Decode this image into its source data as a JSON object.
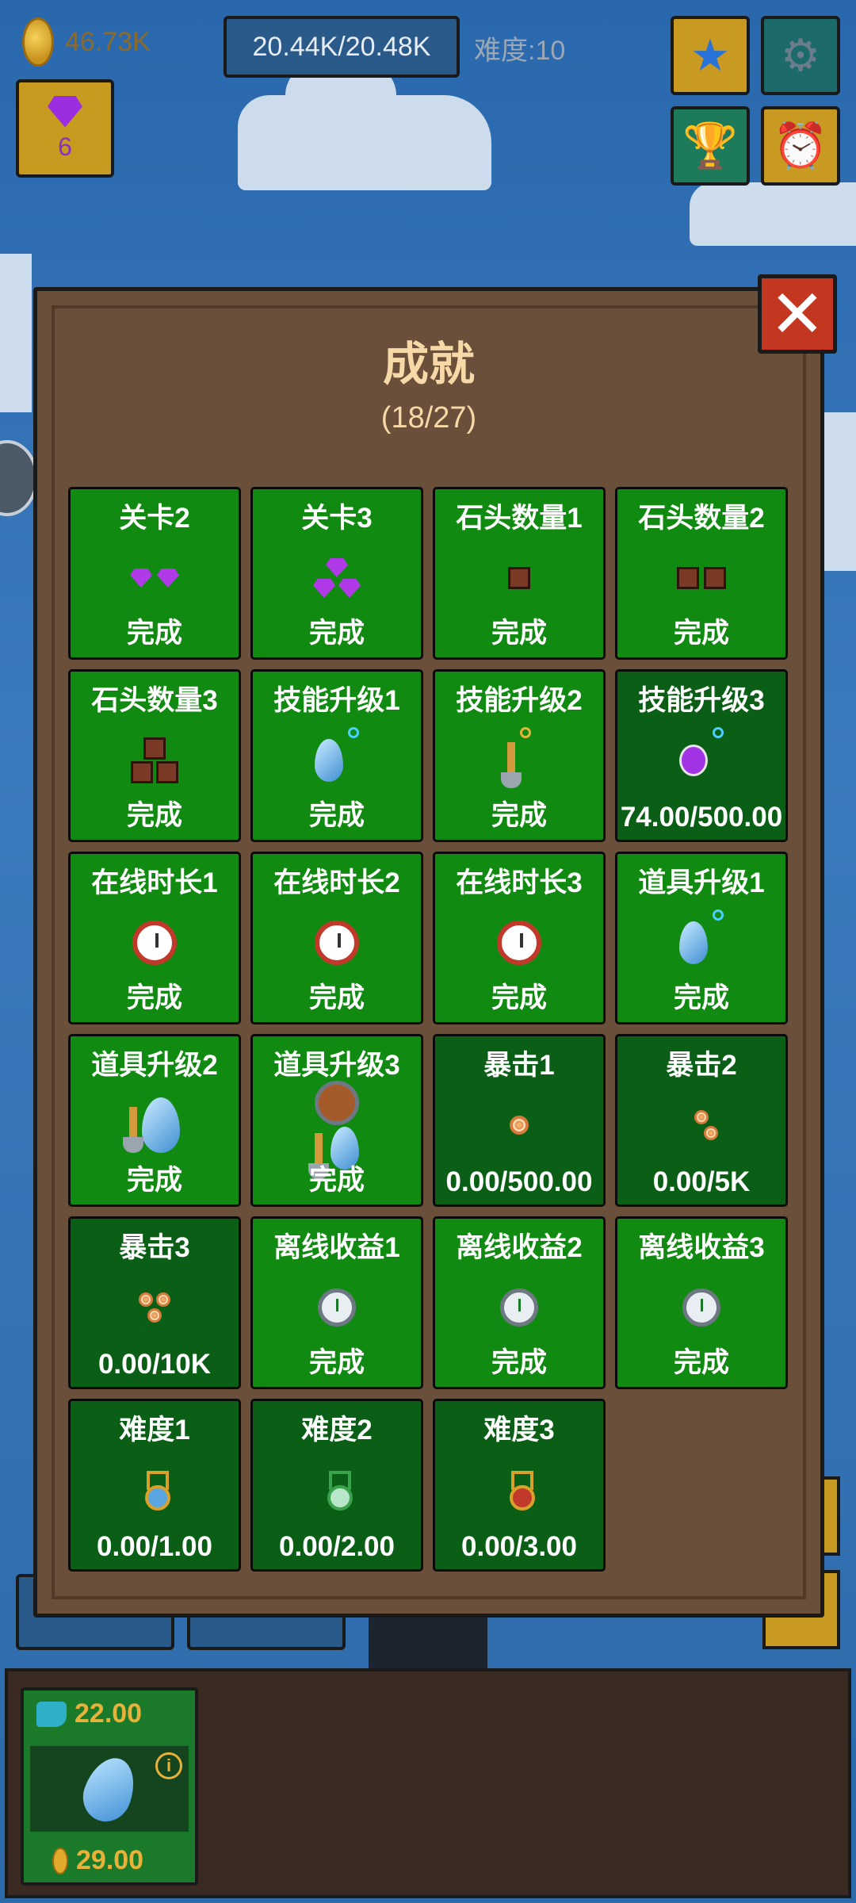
{
  "hud": {
    "coins": "46.73K",
    "capacity": "20.44K/20.48K",
    "difficulty": "难度:10",
    "gems": "6"
  },
  "achievements": {
    "title": "成就",
    "progress": "(18/27)",
    "close_label": "✕",
    "items": [
      {
        "name": "关卡2",
        "status": "完成",
        "icon": "gem-icon",
        "state": "done"
      },
      {
        "name": "关卡3",
        "status": "完成",
        "icon": "gems-icon",
        "state": "done"
      },
      {
        "name": "石头数量1",
        "status": "完成",
        "icon": "stone-icon",
        "state": "done"
      },
      {
        "name": "石头数量2",
        "status": "完成",
        "icon": "stones-icon",
        "state": "done"
      },
      {
        "name": "石头数量3",
        "status": "完成",
        "icon": "stone-pile-icon",
        "state": "done"
      },
      {
        "name": "技能升级1",
        "status": "完成",
        "icon": "water-drop-icon",
        "state": "done"
      },
      {
        "name": "技能升级2",
        "status": "完成",
        "icon": "shovel-icon",
        "state": "done"
      },
      {
        "name": "技能升级3",
        "status": "74.00/500.00",
        "icon": "potion-icon",
        "state": "pending"
      },
      {
        "name": "在线时长1",
        "status": "完成",
        "icon": "clock-icon",
        "state": "done"
      },
      {
        "name": "在线时长2",
        "status": "完成",
        "icon": "clock-icon",
        "state": "done"
      },
      {
        "name": "在线时长3",
        "status": "完成",
        "icon": "clock-icon",
        "state": "done"
      },
      {
        "name": "道具升级1",
        "status": "完成",
        "icon": "water-drop-icon",
        "state": "done"
      },
      {
        "name": "道具升级2",
        "status": "完成",
        "icon": "shovel-drop-icon",
        "state": "done"
      },
      {
        "name": "道具升级3",
        "status": "完成",
        "icon": "shield-shovel-drop-icon",
        "state": "done"
      },
      {
        "name": "暴击1",
        "status": "0.00/500.00",
        "icon": "target-icon",
        "state": "pending"
      },
      {
        "name": "暴击2",
        "status": "0.00/5K",
        "icon": "targets-icon",
        "state": "pending"
      },
      {
        "name": "暴击3",
        "status": "0.00/10K",
        "icon": "target-cluster-icon",
        "state": "pending"
      },
      {
        "name": "离线收益1",
        "status": "完成",
        "icon": "stopwatch-icon",
        "state": "done"
      },
      {
        "name": "离线收益2",
        "status": "完成",
        "icon": "stopwatch-icon",
        "state": "done"
      },
      {
        "name": "离线收益3",
        "status": "完成",
        "icon": "stopwatch-icon",
        "state": "done"
      },
      {
        "name": "难度1",
        "status": "0.00/1.00",
        "icon": "medal-blue-icon",
        "state": "pending"
      },
      {
        "name": "难度2",
        "status": "0.00/2.00",
        "icon": "medal-green-icon",
        "state": "pending"
      },
      {
        "name": "难度3",
        "status": "0.00/3.00",
        "icon": "medal-red-icon",
        "state": "pending"
      }
    ]
  },
  "shop_item": {
    "upgrade_cost": "22.00",
    "coin_cost": "29.00",
    "info_label": "i"
  },
  "colors": {
    "done": "#108a10",
    "pending": "#0b5e16",
    "panel": "#6a4f3a",
    "title_text": "#f7d9a8"
  }
}
